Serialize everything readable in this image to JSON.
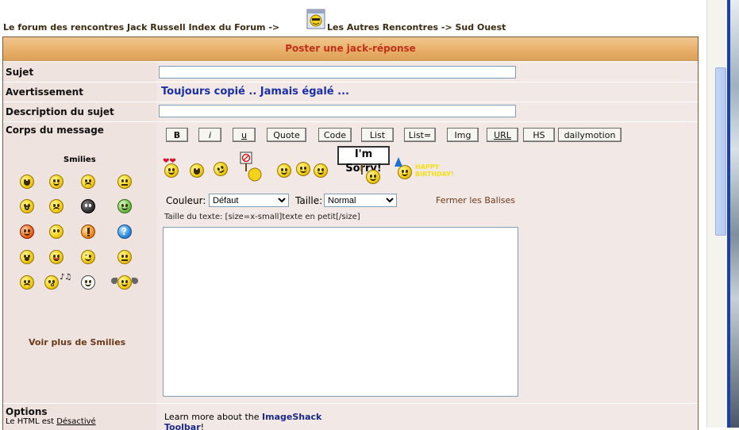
{
  "breadcrumb": {
    "part1": "Le forum des rencontres Jack Russell Index du Forum ->",
    "part2": "Les Autres Rencontres -> Sud Ouest"
  },
  "form": {
    "header": "Poster une jack-réponse",
    "subject_label": "Sujet",
    "subject_value": "",
    "warning_label": "Avertissement",
    "warning_text": "Toujours copié .. Jamais égalé ...",
    "description_label": "Description du sujet",
    "description_value": "",
    "body_label": "Corps du message",
    "smilies_title": "Smilies",
    "more_smilies": "Voir plus de Smilies",
    "buttons": [
      "B",
      "i",
      "u",
      "Quote",
      "Code",
      "List",
      "List=",
      "Img",
      "URL",
      "HS",
      "dailymotion"
    ],
    "color_label": "Couleur:",
    "color_value": "Défaut",
    "size_label": "Taille:",
    "size_value": "Normal",
    "close_tags": "Fermer les Balises",
    "help_line": "Taille du texte: [size=x-small]texte en petit[/size]",
    "message_value": "",
    "sorry_sign": "I'm Sorry!",
    "birthday_text": "HAPPY BIRTHDAY!",
    "options_label": "Options",
    "html_status_prefix": "Le HTML est ",
    "html_status_value": "Désactivé",
    "imageshack_prefix": "Learn more about the ",
    "imageshack_link": "ImageShack",
    "imageshack_link2": "Toolbar",
    "imageshack_suffix": "!"
  },
  "colors": {
    "header_text": "#c0301a",
    "warning_text": "#1b2fa6",
    "link_brown": "#6b3a1a"
  }
}
